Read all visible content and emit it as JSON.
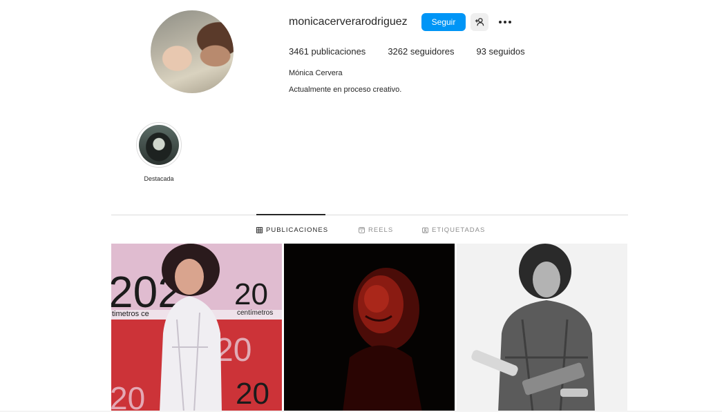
{
  "profile": {
    "username": "monicacerverarodriguez",
    "follow_label": "Seguir",
    "stats": {
      "posts": "3461 publicaciones",
      "followers": "3262 seguidores",
      "following": "93 seguidos"
    },
    "full_name": "Mónica Cervera",
    "bio": "Actualmente en proceso creativo."
  },
  "highlights": [
    {
      "label": "Destacada"
    }
  ],
  "tabs": [
    {
      "label": "PUBLICACIONES",
      "icon": "grid-icon",
      "active": true
    },
    {
      "label": "REELS",
      "icon": "reels-icon",
      "active": false
    },
    {
      "label": "ETIQUETADAS",
      "icon": "tagged-icon",
      "active": false
    }
  ],
  "poster_texts": {
    "big": "20",
    "big_2022": "202",
    "small": "centímetros",
    "strip": "timetros ce"
  },
  "colors": {
    "accent": "#0095f6",
    "text": "#262626",
    "muted": "#8e8e8e",
    "border": "#dbdbdb"
  }
}
